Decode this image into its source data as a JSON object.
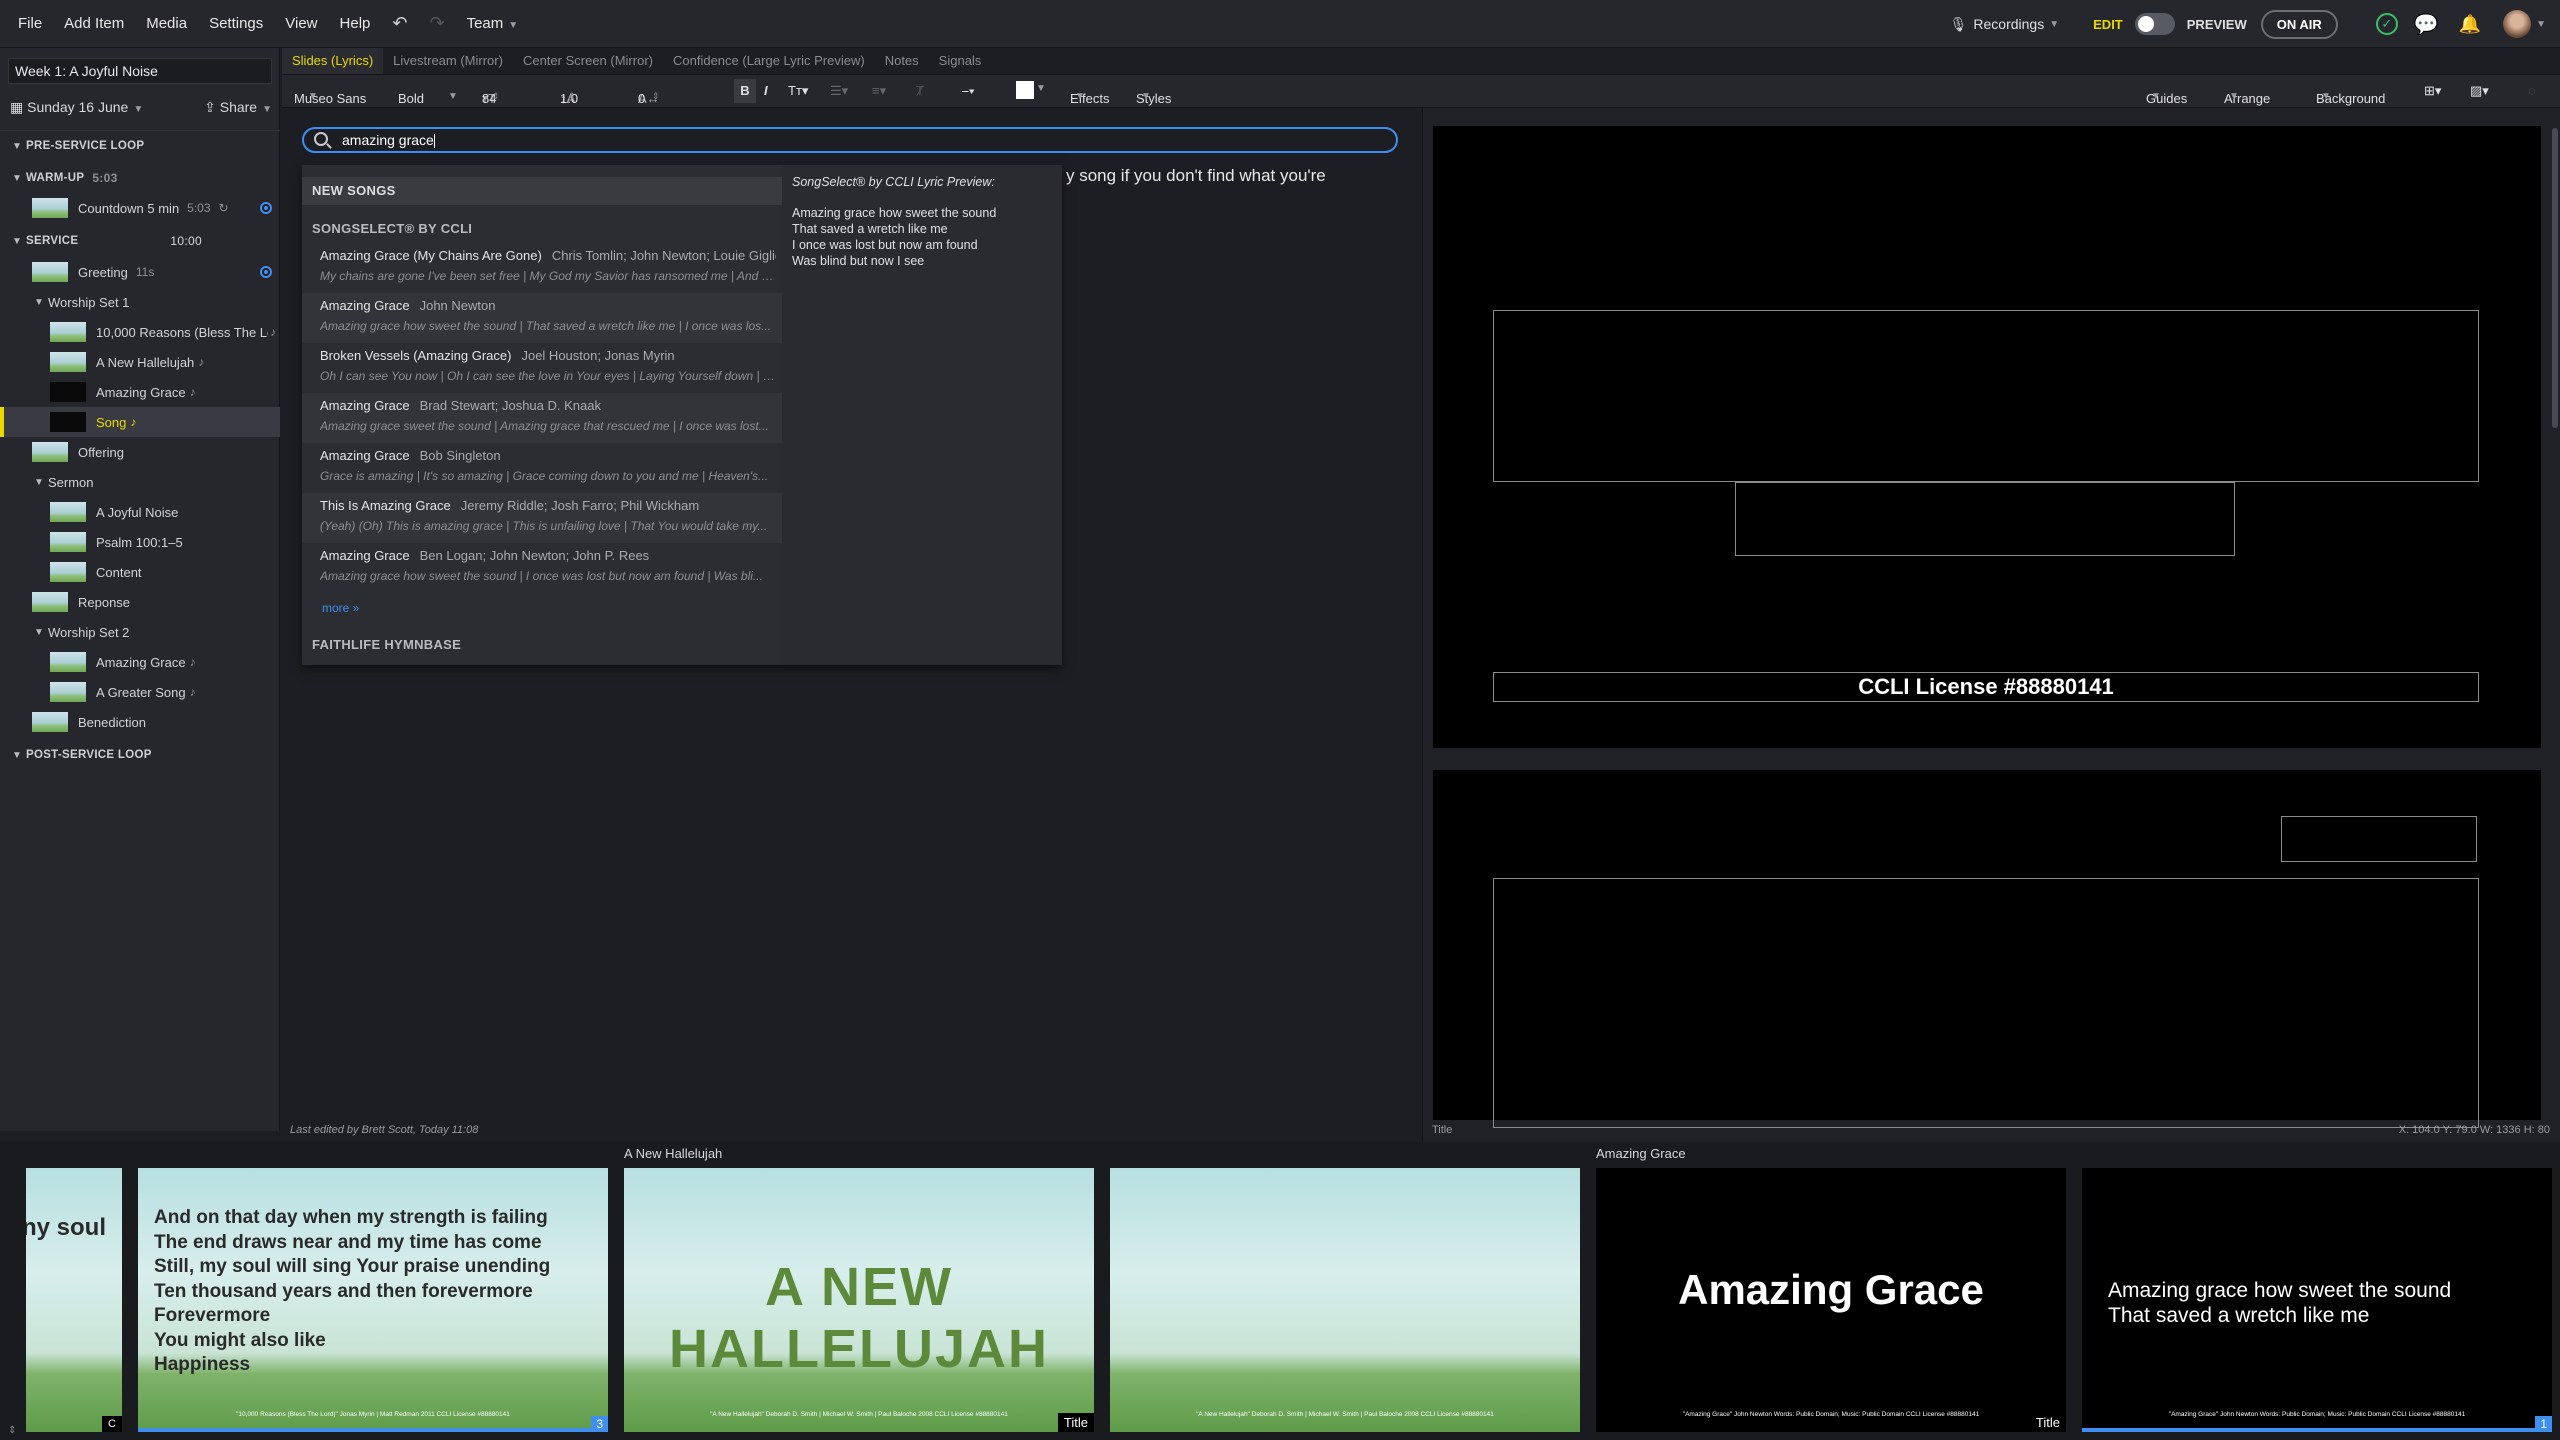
{
  "menu": {
    "file": "File",
    "add_item": "Add Item",
    "media": "Media",
    "settings": "Settings",
    "view": "View",
    "help": "Help",
    "team": "Team"
  },
  "topright": {
    "recordings": "Recordings",
    "edit": "EDIT",
    "preview": "PREVIEW",
    "on_air": "ON AIR"
  },
  "sidebar": {
    "presentation_title": "Week 1: A Joyful Noise",
    "date": "Sunday 16 June",
    "share": "Share",
    "items": [
      {
        "label": "PRE-SERVICE LOOP",
        "meta": ""
      },
      {
        "label": "WARM-UP",
        "meta": "5:03"
      },
      {
        "label": "Countdown 5 min",
        "meta": "5:03"
      },
      {
        "label": "SERVICE",
        "meta": "10:00"
      },
      {
        "label": "Greeting",
        "meta": "11s"
      },
      {
        "label": "Worship Set 1",
        "meta": ""
      },
      {
        "label": "10,000 Reasons (Bless The Lo...",
        "meta": "♪"
      },
      {
        "label": "A New Hallelujah",
        "meta": "♪"
      },
      {
        "label": "Amazing Grace",
        "meta": "♪"
      },
      {
        "label": "Song",
        "meta": "♪"
      },
      {
        "label": "Offering",
        "meta": ""
      },
      {
        "label": "Sermon",
        "meta": ""
      },
      {
        "label": "A Joyful Noise",
        "meta": ""
      },
      {
        "label": "Psalm 100:1–5",
        "meta": ""
      },
      {
        "label": "Content",
        "meta": ""
      },
      {
        "label": "Reponse",
        "meta": ""
      },
      {
        "label": "Worship Set 2",
        "meta": ""
      },
      {
        "label": "Amazing Grace",
        "meta": "♪"
      },
      {
        "label": "A Greater Song",
        "meta": "♪"
      },
      {
        "label": "Benediction",
        "meta": ""
      },
      {
        "label": "POST-SERVICE LOOP",
        "meta": ""
      }
    ]
  },
  "tabs": [
    "Slides (Lyrics)",
    "Livestream (Mirror)",
    "Center Screen (Mirror)",
    "Confidence (Large Lyric Preview)",
    "Notes",
    "Signals"
  ],
  "format": {
    "font": "Museo Sans",
    "weight": "Bold",
    "size": "84",
    "line_height": "1.0",
    "spacing": "0",
    "effects": "Effects",
    "styles": "Styles",
    "guides": "Guides",
    "arrange": "Arrange",
    "background": "Background"
  },
  "search": {
    "value": "amazing grace",
    "bg_text": "y song if you don't find what you're"
  },
  "results": {
    "new_songs": "NEW SONGS",
    "songselect": "SONGSELECT® BY CCLI",
    "faithlife": "FAITHLIFE HYMNBASE",
    "more": "more »",
    "items": [
      {
        "title": "Amazing Grace (My Chains Are Gone)",
        "authors": "Chris Tomlin; John Newton; Louie Giglio",
        "lyrics": "My chains are gone I've been set free | My God my Savior has ransomed me | And li..."
      },
      {
        "title": "Amazing Grace",
        "authors": "John Newton",
        "lyrics": "Amazing grace how sweet the sound | That saved a wretch like me | I once was los..."
      },
      {
        "title": "Broken Vessels (Amazing Grace)",
        "authors": "Joel Houston; Jonas Myrin",
        "lyrics": "Oh I can see You now | Oh I can see the love in Your eyes | Laying Yourself down | R..."
      },
      {
        "title": "Amazing Grace",
        "authors": "Brad Stewart; Joshua D. Knaak",
        "lyrics": "Amazing grace sweet the sound | Amazing grace that rescued me | I once was lost..."
      },
      {
        "title": "Amazing Grace",
        "authors": "Bob Singleton",
        "lyrics": "Grace is amazing | It's so amazing | Grace coming down to you and me | Heaven's..."
      },
      {
        "title": "This Is Amazing Grace",
        "authors": "Jeremy Riddle; Josh Farro; Phil Wickham",
        "lyrics": "(Yeah) (Oh) This is amazing grace | This is unfailing love | That You would take my..."
      },
      {
        "title": "Amazing Grace",
        "authors": "Ben Logan; John Newton; John P. Rees",
        "lyrics": "Amazing grace how sweet the sound | I once was lost but now am found | Was bli..."
      }
    ],
    "preview_header": "SongSelect® by CCLI Lyric Preview:",
    "preview_lines": [
      "Amazing grace how sweet the sound",
      "That saved a wretch like me",
      "I once was lost but now am found",
      "Was blind but now I see"
    ]
  },
  "editor_footer": "Last edited by Brett Scott, Today 11:08",
  "canvas": {
    "ccli": "CCLI License #88880141",
    "footer_label": "Title",
    "coords": "X: 104.0  Y: 79.0    W: 1336  H: 80"
  },
  "filmstrip": {
    "group_labels": [
      "A New Hallelujah",
      "Amazing Grace"
    ],
    "slide1_partial": "ny soul",
    "slide1_badge": "C",
    "slide2_lines": [
      "And on that day when my strength is failing",
      "The end draws near and my time has come",
      "Still, my soul will sing Your praise unending",
      "Ten thousand years and then forevermore",
      "Forevermore",
      "You might also like",
      "Happiness"
    ],
    "slide2_credit": "\"10,000 Reasons (Bless The Lord)\" Jonas Myrin | Matt Redman 2011 CCLI License #88880141",
    "slide2_badge": "3",
    "slide3_title": "A NEW HALLELUJAH",
    "slide3_credit": "\"A New Hallelujah\" Deborah D. Smith | Michael W. Smith | Paul Baloche 2008 CCLI License #88880141",
    "slide3_badge": "Title",
    "slide4_credit": "\"A New Hallelujah\" Deborah D. Smith | Michael W. Smith | Paul Baloche 2008 CCLI License #88880141",
    "slide5_title": "Amazing Grace",
    "slide5_credit": "\"Amazing Grace\" John Newton Words: Public Domain; Music: Public Domain CCLI License #88880141",
    "slide5_badge": "Title",
    "slide6_lines": [
      "Amazing grace how sweet the sound",
      "That saved a wretch like me"
    ],
    "slide6_credit": "\"Amazing Grace\" John Newton Words: Public Domain; Music: Public Domain CCLI License #88880141",
    "slide6_badge": "1"
  },
  "colors": {
    "accent": "#3e8ff0",
    "active_tab": "#e8d900",
    "on_air_border": "#6c6e76"
  }
}
